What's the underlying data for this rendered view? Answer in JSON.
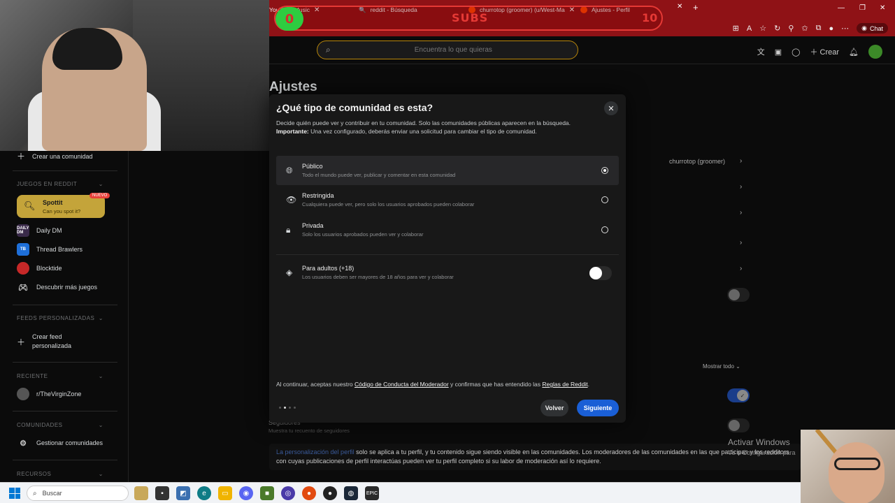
{
  "browser": {
    "tabs": [
      {
        "label": "YouTube Music"
      },
      {
        "label": "reddit - Búsqueda"
      },
      {
        "label": "churrotop (groomer) (u/West-Ma"
      },
      {
        "label": "Ajustes - Perfil"
      }
    ],
    "chat_label": "Chat",
    "subs_overlay": {
      "left_count": "0",
      "label": "SUBS",
      "right_count": "10"
    }
  },
  "header": {
    "search_placeholder": "Encuentra lo que quieras",
    "create_label": "Crear"
  },
  "sidebar": {
    "create_community": "Crear una comunidad",
    "games_section": "JUEGOS EN REDDIT",
    "spottit": {
      "title": "Spottit",
      "subtitle": "Can you spot it?",
      "badge": "NUEVO"
    },
    "games": [
      {
        "label": "Daily DM",
        "icon_text": "DAILY DM"
      },
      {
        "label": "Thread Brawlers",
        "icon_text": "TB"
      },
      {
        "label": "Blocktide",
        "icon_text": ""
      },
      {
        "label": "Descubrir más juegos",
        "icon_text": ""
      }
    ],
    "feeds_section": "FEEDS PERSONALIZADAS",
    "create_feed": "Crear feed personalizada",
    "recent_section": "RECIENTE",
    "recent_item": "r/TheVirginZone",
    "communities_section": "COMUNIDADES",
    "manage_communities": "Gestionar comunidades",
    "resources_section": "RECURSOS"
  },
  "page": {
    "title": "Ajustes",
    "profile_name": "churrotop (groomer)",
    "show_all": "Mostrar todo",
    "followers_label": "Seguidores",
    "followers_sub": "Muestra tu recuento de seguidores",
    "note_link": "La personalización del perfil",
    "note_text": " solo se aplica a tu perfil, y tu contenido sigue siendo visible en las comunidades. Los moderadores de las comunidades en las que participas y los redditors con cuyas publicaciones de perfil interactúas pueden ver tu perfil completo si su labor de moderación así lo requiere."
  },
  "modal": {
    "title": "¿Qué tipo de comunidad es esta?",
    "desc": "Decide quién puede ver y contribuir en tu comunidad. Solo las comunidades públicas aparecen en la búsqueda.",
    "important_label": "Importante:",
    "important_text": " Una vez configurado, deberás enviar una solicitud para cambiar el tipo de comunidad.",
    "options": [
      {
        "title": "Público",
        "subtitle": "Todo el mundo puede ver, publicar y comentar en esta comunidad",
        "selected": true
      },
      {
        "title": "Restringida",
        "subtitle": "Cualquiera puede ver, pero solo los usuarios aprobados pueden colaborar",
        "selected": false
      },
      {
        "title": "Privada",
        "subtitle": "Solo los usuarios aprobados pueden ver y colaborar",
        "selected": false
      }
    ],
    "adult": {
      "title": "Para adultos (+18)",
      "subtitle": "Los usuarios deben ser mayores de 18 años para ver y colaborar",
      "enabled": false
    },
    "footnote_prefix": "Al continuar, aceptas nuestro ",
    "footnote_link1": "Código de Conducta del Moderador",
    "footnote_mid": " y confirmas que has entendido las ",
    "footnote_link2": "Reglas de Reddit",
    "footnote_suffix": ".",
    "back_label": "Volver",
    "next_label": "Siguiente",
    "step": 2,
    "steps": 4
  },
  "windows": {
    "activate_title": "Activar Windows",
    "activate_sub": "Ve a Configuración para",
    "search_label": "Buscar"
  },
  "colors": {
    "accent_blue": "#1a5fd6",
    "browser_red": "#8f1216",
    "spottit_gold": "#c4a43a"
  }
}
